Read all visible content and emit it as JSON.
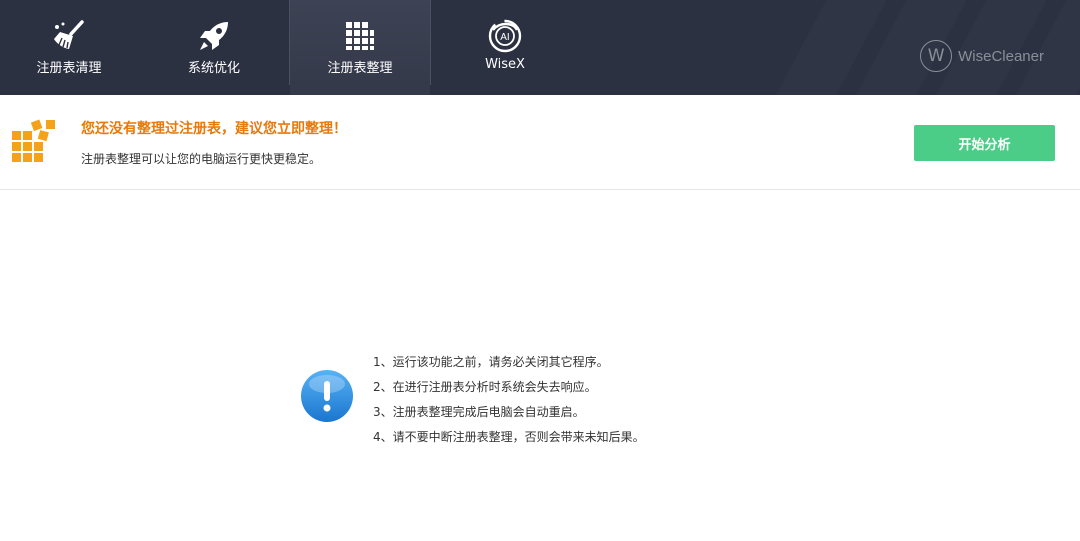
{
  "nav": {
    "tabs": [
      {
        "label": "注册表清理",
        "icon": "broom-icon",
        "active": false
      },
      {
        "label": "系统优化",
        "icon": "rocket-icon",
        "active": false
      },
      {
        "label": "注册表整理",
        "icon": "grid-blocks-icon",
        "active": true
      },
      {
        "label": "WiseX",
        "icon": "ai-swirl-icon",
        "active": false
      }
    ],
    "brand": {
      "logo_letter": "W",
      "name": "WiseCleaner"
    }
  },
  "banner": {
    "title": "您还没有整理过注册表，建议您立即整理！",
    "subtitle": "注册表整理可以让您的电脑运行更快更稳定。",
    "button_label": "开始分析"
  },
  "notice": {
    "icon": "info-exclamation-icon",
    "items": [
      "1、运行该功能之前，请务必关闭其它程序。",
      "2、在进行注册表分析时系统会失去响应。",
      "3、注册表整理完成后电脑会自动重启。",
      "4、请不要中断注册表整理，否则会带来未知后果。"
    ]
  },
  "colors": {
    "header_bg": "#2c3142",
    "accent_orange": "#e8790b",
    "button_green": "#4ccd87",
    "info_blue": "#2b8be0"
  }
}
